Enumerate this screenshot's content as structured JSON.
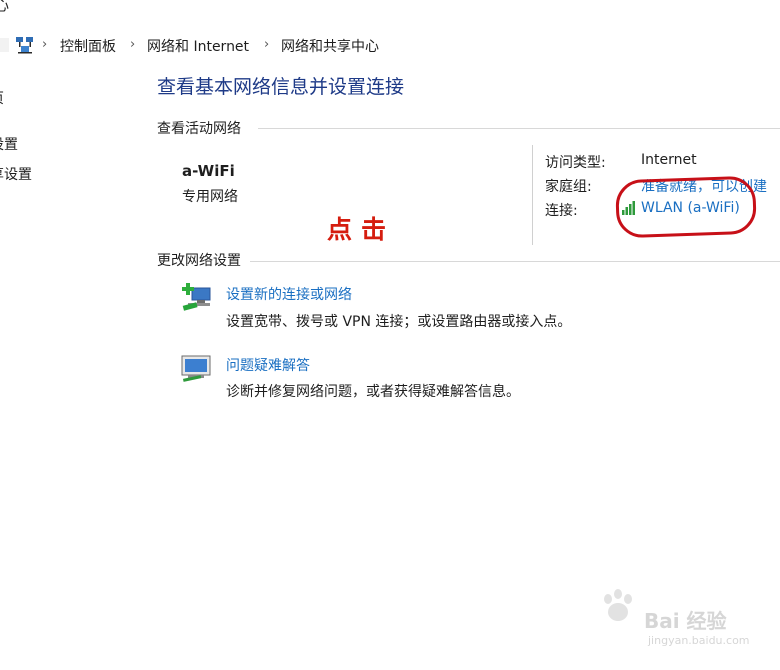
{
  "window": {
    "title_fragment": "心"
  },
  "breadcrumb": {
    "items": [
      "控制面板",
      "网络和 Internet",
      "网络和共享中心"
    ],
    "separator": "›"
  },
  "left_pane": {
    "items": [
      "页",
      "设置",
      "享设置"
    ]
  },
  "main": {
    "heading": "查看基本网络信息并设置连接",
    "active_networks_label": "查看活动网络",
    "network": {
      "name": "a-WiFi",
      "type": "专用网络",
      "access_type_label": "访问类型:",
      "access_type_value": "Internet",
      "homegroup_label": "家庭组:",
      "homegroup_value": "准备就绪，可以创建",
      "connections_label": "连接:",
      "connections_value": "WLAN (a-WiFi)"
    },
    "change_settings_label": "更改网络设置",
    "tasks": [
      {
        "title": "设置新的连接或网络",
        "desc": "设置宽带、拨号或 VPN 连接；或设置路由器或接入点。",
        "icon": "new-connection-icon"
      },
      {
        "title": "问题疑难解答",
        "desc": "诊断并修复网络问题，或者获得疑难解答信息。",
        "icon": "troubleshoot-icon"
      }
    ]
  },
  "annotation": {
    "click_note": "点击",
    "highlight_color": "#c71018"
  },
  "watermark": {
    "brand": "Bai 经验",
    "url": "jingyan.baidu.com"
  },
  "colors": {
    "link": "#1a6fc2",
    "heading": "#1e3a87",
    "annotation": "#d51d0f"
  }
}
